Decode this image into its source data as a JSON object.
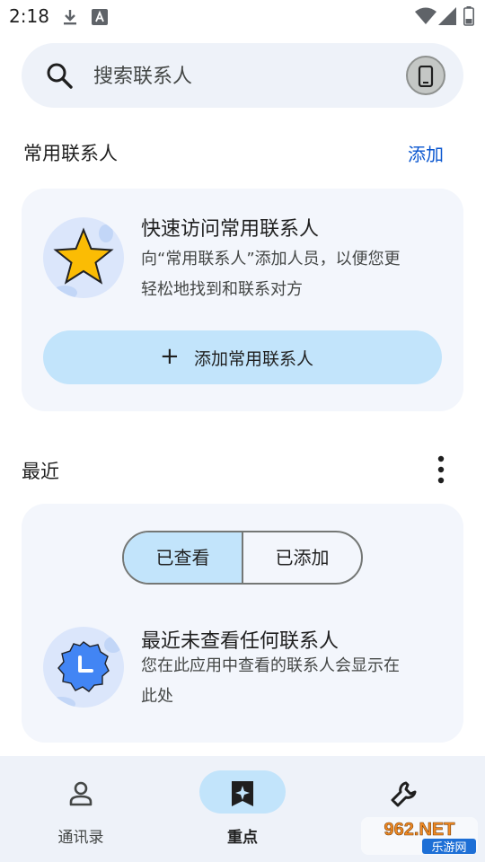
{
  "status_bar": {
    "time": "2:18"
  },
  "search": {
    "placeholder": "搜索联系人"
  },
  "favorites": {
    "title": "常用联系人",
    "add_link": "添加",
    "card": {
      "heading": "快速访问常用联系人",
      "body_line1": "向“常用联系人”添加人员，以便您更",
      "body_line2": "轻松地找到和联系对方",
      "button_label": "添加常用联系人"
    }
  },
  "recent": {
    "title": "最近",
    "segments": [
      "已查看",
      "已添加"
    ],
    "selected_segment": "已查看",
    "empty_heading": "最近未查看任何联系人",
    "empty_body_line1": "您在此应用中查看的联系人会显示在",
    "empty_body_line2": "此处"
  },
  "bottom_nav": {
    "items": [
      {
        "label": "通讯录",
        "icon": "person-icon",
        "active": false
      },
      {
        "label": "重点",
        "icon": "sparkle-bookmark-icon",
        "active": true
      },
      {
        "label": "",
        "icon": "wrench-icon",
        "active": false
      }
    ]
  },
  "watermark": {
    "text_top": "962.NET",
    "text_bottom": "乐游网"
  },
  "colors": {
    "accent": "#0b57d0",
    "button_tonal": "#c2e4fb",
    "card_bg": "#f3f6fc",
    "search_bg": "#eef2f9",
    "star": "#fbbc04"
  }
}
